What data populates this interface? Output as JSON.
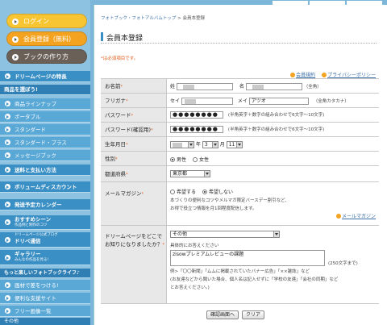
{
  "sidebar": {
    "login": "ログイン",
    "member_register": "会員登録（無料）",
    "howto": "ブックの作り方",
    "dream_features": "ドリームページの特長",
    "choose_product": "商品を選ぼう!",
    "products": [
      "商品ラインナップ",
      "ポータブル",
      "スタンダード",
      "スタンダード・プラス",
      "メッセージブック"
    ],
    "shipping": "送料と支払い方法",
    "volume": "ボリュームディスカウント",
    "calendar": "発送予定カレンダー",
    "recommend": "おすすめシーン",
    "recommend_sub": "作品例と制作のコツ",
    "blog": "ドリームページ公式ブログ",
    "blog_main": "ドリペ通信",
    "gallery": "ギャラリー",
    "gallery_sub": "みんなの作品を見る!",
    "more": "もっと楽しいフォトブックライフ♪",
    "more_items": [
      "画材で差をつける!",
      "便利な支援サイト",
      "フリー画像一覧"
    ],
    "other": "その他"
  },
  "breadcrumb": {
    "home": "フォトブック・フォトアルバムトップ",
    "sep": ">",
    "current": "会員本登録"
  },
  "page_title": "会員本登録",
  "required_note": "*は必須項目です。",
  "links": {
    "terms": "会員規約",
    "privacy": "プライバシーポリシー"
  },
  "form": {
    "name": {
      "label": "お名前",
      "mark": "*",
      "sei": "姓",
      "mei": "名",
      "hint": "（全角）"
    },
    "kana": {
      "label": "フリガナ",
      "mark": "*",
      "sei": "セイ",
      "mei": "メイ",
      "mei_value": "アツオ",
      "hint": "（全角カタカナ）"
    },
    "password": {
      "label": "パスワード",
      "mark": "*",
      "value": "●●●●●●●●",
      "hint": "(半角英字＋数字の組み合わせで6文字〜10文字)"
    },
    "password_confirm": {
      "label": "パスワード(確認用)",
      "mark": "*",
      "value": "●●●●●●●●",
      "hint": "(半角英字＋数字の組み合わせで6文字〜10文字)"
    },
    "birthday": {
      "label": "生年月日",
      "mark": "*",
      "year_unit": "年",
      "month": "3",
      "month_unit": "月",
      "day": "11"
    },
    "gender": {
      "label": "性別",
      "mark": "*",
      "male": "男性",
      "female": "女性"
    },
    "prefecture": {
      "label": "都道府県",
      "mark": "*",
      "value": "東京都"
    },
    "magazine": {
      "label": "メールマガジン",
      "mark": "*",
      "yes": "希望する",
      "no": "希望しない",
      "desc1": "本づくりの便利なコツやメルマガ限定バースデー割引など、",
      "desc2": "お得で役立つ情報を月1回程度配信します。",
      "link": "メールマガジン"
    },
    "source": {
      "label1": "ドリームページをどこで",
      "label2": "お知りになりましたか？",
      "mark": "*",
      "select": "その他",
      "detail_label": "具体的にお答えください",
      "detail_value": "zisowプレミアムレビューの課題",
      "limit": "(250文字まで)",
      "example1": "例>「〇〇新聞」「ムムに掲載されていたバナー広告」「××雑誌」など",
      "example2": "(お友達などから聞いた場合、個人名は記入せずに「学校の友達」「会社の同期」など",
      "example3": "とお答えください。)"
    }
  },
  "buttons": {
    "confirm": "確認画面へ",
    "clear": "クリア"
  }
}
